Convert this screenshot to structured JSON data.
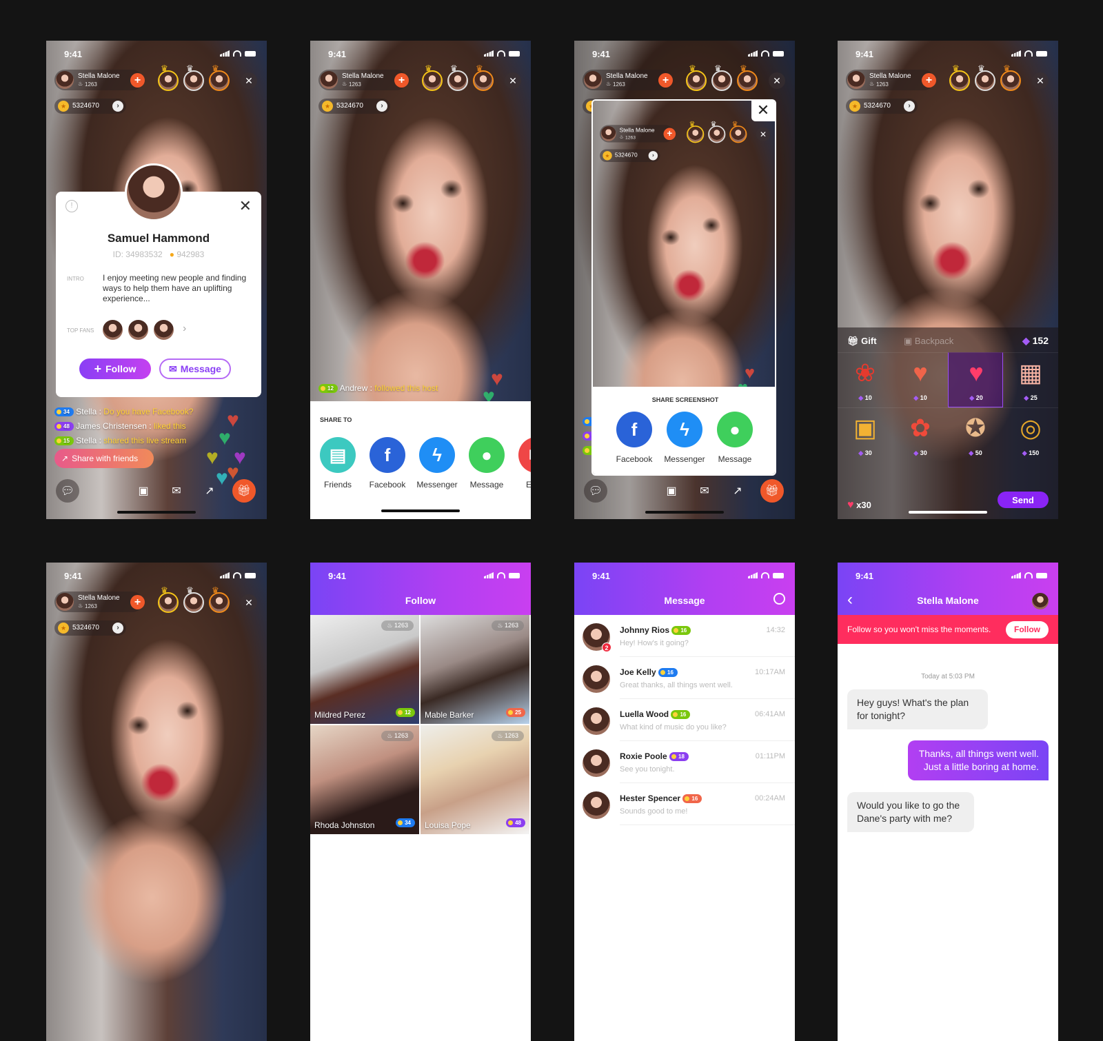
{
  "status": {
    "time": "9:41"
  },
  "live": {
    "host_name": "Stella Malone",
    "host_likes": "1263",
    "coins": "5324670"
  },
  "profile": {
    "name": "Samuel Hammond",
    "id": "ID: 34983532",
    "coins": "942983",
    "intro_label": "INTRO",
    "intro": "I enjoy meeting new people and finding ways to help them have an uplifting experience...",
    "top_fans_label": "TOP FANS",
    "follow": "Follow",
    "message": "Message"
  },
  "comments": [
    {
      "level": "34",
      "color": "#1e7bf0",
      "user": "Stella :",
      "text": "Do you have Facebook?"
    },
    {
      "level": "48",
      "color": "#8b3ef0",
      "user": "James Christensen :",
      "text": "liked this"
    },
    {
      "level": "15",
      "color": "#7ac70c",
      "user": "Stella :",
      "text": "shared this live stream"
    }
  ],
  "share_friends": "Share with friends",
  "andrew": {
    "level": "12",
    "color": "#7ac70c",
    "user": "Andrew :",
    "text": "followed this host"
  },
  "share_sheet": {
    "title": "SHARE TO",
    "items": [
      {
        "label": "Friends",
        "icon": "contacts-icon",
        "color": "#3cc9c0"
      },
      {
        "label": "Facebook",
        "icon": "facebook-icon",
        "color": "#2a63d8"
      },
      {
        "label": "Messenger",
        "icon": "messenger-icon",
        "color": "#1f8ef5"
      },
      {
        "label": "Message",
        "icon": "message-bubble-icon",
        "color": "#3fcf5c"
      },
      {
        "label": "Email",
        "icon": "email-icon",
        "color": "#ef4646"
      }
    ]
  },
  "share_screenshot": {
    "title": "SHARE SCREENSHOT",
    "items": [
      {
        "label": "Facebook",
        "icon": "facebook-icon",
        "color": "#2a63d8"
      },
      {
        "label": "Messenger",
        "icon": "messenger-icon",
        "color": "#1f8ef5"
      },
      {
        "label": "Message",
        "icon": "message-bubble-icon",
        "color": "#3fcf5c"
      }
    ]
  },
  "gift": {
    "tab_gift": "Gift",
    "tab_backpack": "Backpack",
    "balance": "152",
    "combo": "x30",
    "send": "Send",
    "items": [
      {
        "icon": "rose-icon",
        "price": "10",
        "selected": false
      },
      {
        "icon": "heart-cake-icon",
        "price": "10",
        "selected": false
      },
      {
        "icon": "heart-balloons-icon",
        "price": "20",
        "selected": true
      },
      {
        "icon": "birthday-cake-icon",
        "price": "25",
        "selected": false
      },
      {
        "icon": "gift-box-icon",
        "price": "30",
        "selected": false
      },
      {
        "icon": "tulips-icon",
        "price": "30",
        "selected": false
      },
      {
        "icon": "puppy-icon",
        "price": "50",
        "selected": false
      },
      {
        "icon": "rings-icon",
        "price": "150",
        "selected": false
      }
    ]
  },
  "follow_page": {
    "title": "Follow",
    "cards": [
      {
        "name": "Mildred Perez",
        "level": "12",
        "color": "#7ac70c",
        "likes": "1263"
      },
      {
        "name": "Mable Barker",
        "level": "25",
        "color": "#f0664a",
        "likes": "1263"
      },
      {
        "name": "Rhoda Johnston",
        "level": "34",
        "color": "#1e7bf0",
        "likes": "1263"
      },
      {
        "name": "Louisa Pope",
        "level": "48",
        "color": "#8b3ef0",
        "likes": "1263"
      }
    ]
  },
  "messages": {
    "title": "Message",
    "items": [
      {
        "name": "Johnny Rios",
        "level": "16",
        "color": "#7ac70c",
        "time": "14:32",
        "preview": "Hey! How's it going?",
        "unread": "2"
      },
      {
        "name": "Joe Kelly",
        "level": "16",
        "color": "#1e7bf0",
        "time": "10:17AM",
        "preview": "Great thanks, all things went well."
      },
      {
        "name": "Luella Wood",
        "level": "16",
        "color": "#7ac70c",
        "time": "06:41AM",
        "preview": "What kind of music do you like?"
      },
      {
        "name": "Roxie Poole",
        "level": "18",
        "color": "#8b3ef0",
        "time": "01:11PM",
        "preview": "See you tonight."
      },
      {
        "name": "Hester Spencer",
        "level": "16",
        "color": "#f0664a",
        "time": "00:24AM",
        "preview": "Sounds good to me!"
      }
    ]
  },
  "chat": {
    "title": "Stella Malone",
    "banner": "Follow so you won't miss the moments.",
    "follow": "Follow",
    "timestamp": "Today at 5:03 PM",
    "messages": [
      {
        "side": "in",
        "text": "Hey guys! What's the plan for tonight?"
      },
      {
        "side": "out",
        "text": "Thanks, all things went well. Just a little boring at home."
      },
      {
        "side": "in",
        "text": "Would you like to go the Dane's party with me?"
      }
    ]
  },
  "colors": {
    "accent": "#8a3ff5",
    "accent_end": "#c440f0",
    "live_orange": "#f0582a",
    "banner_pink": "#ff2d5e"
  }
}
